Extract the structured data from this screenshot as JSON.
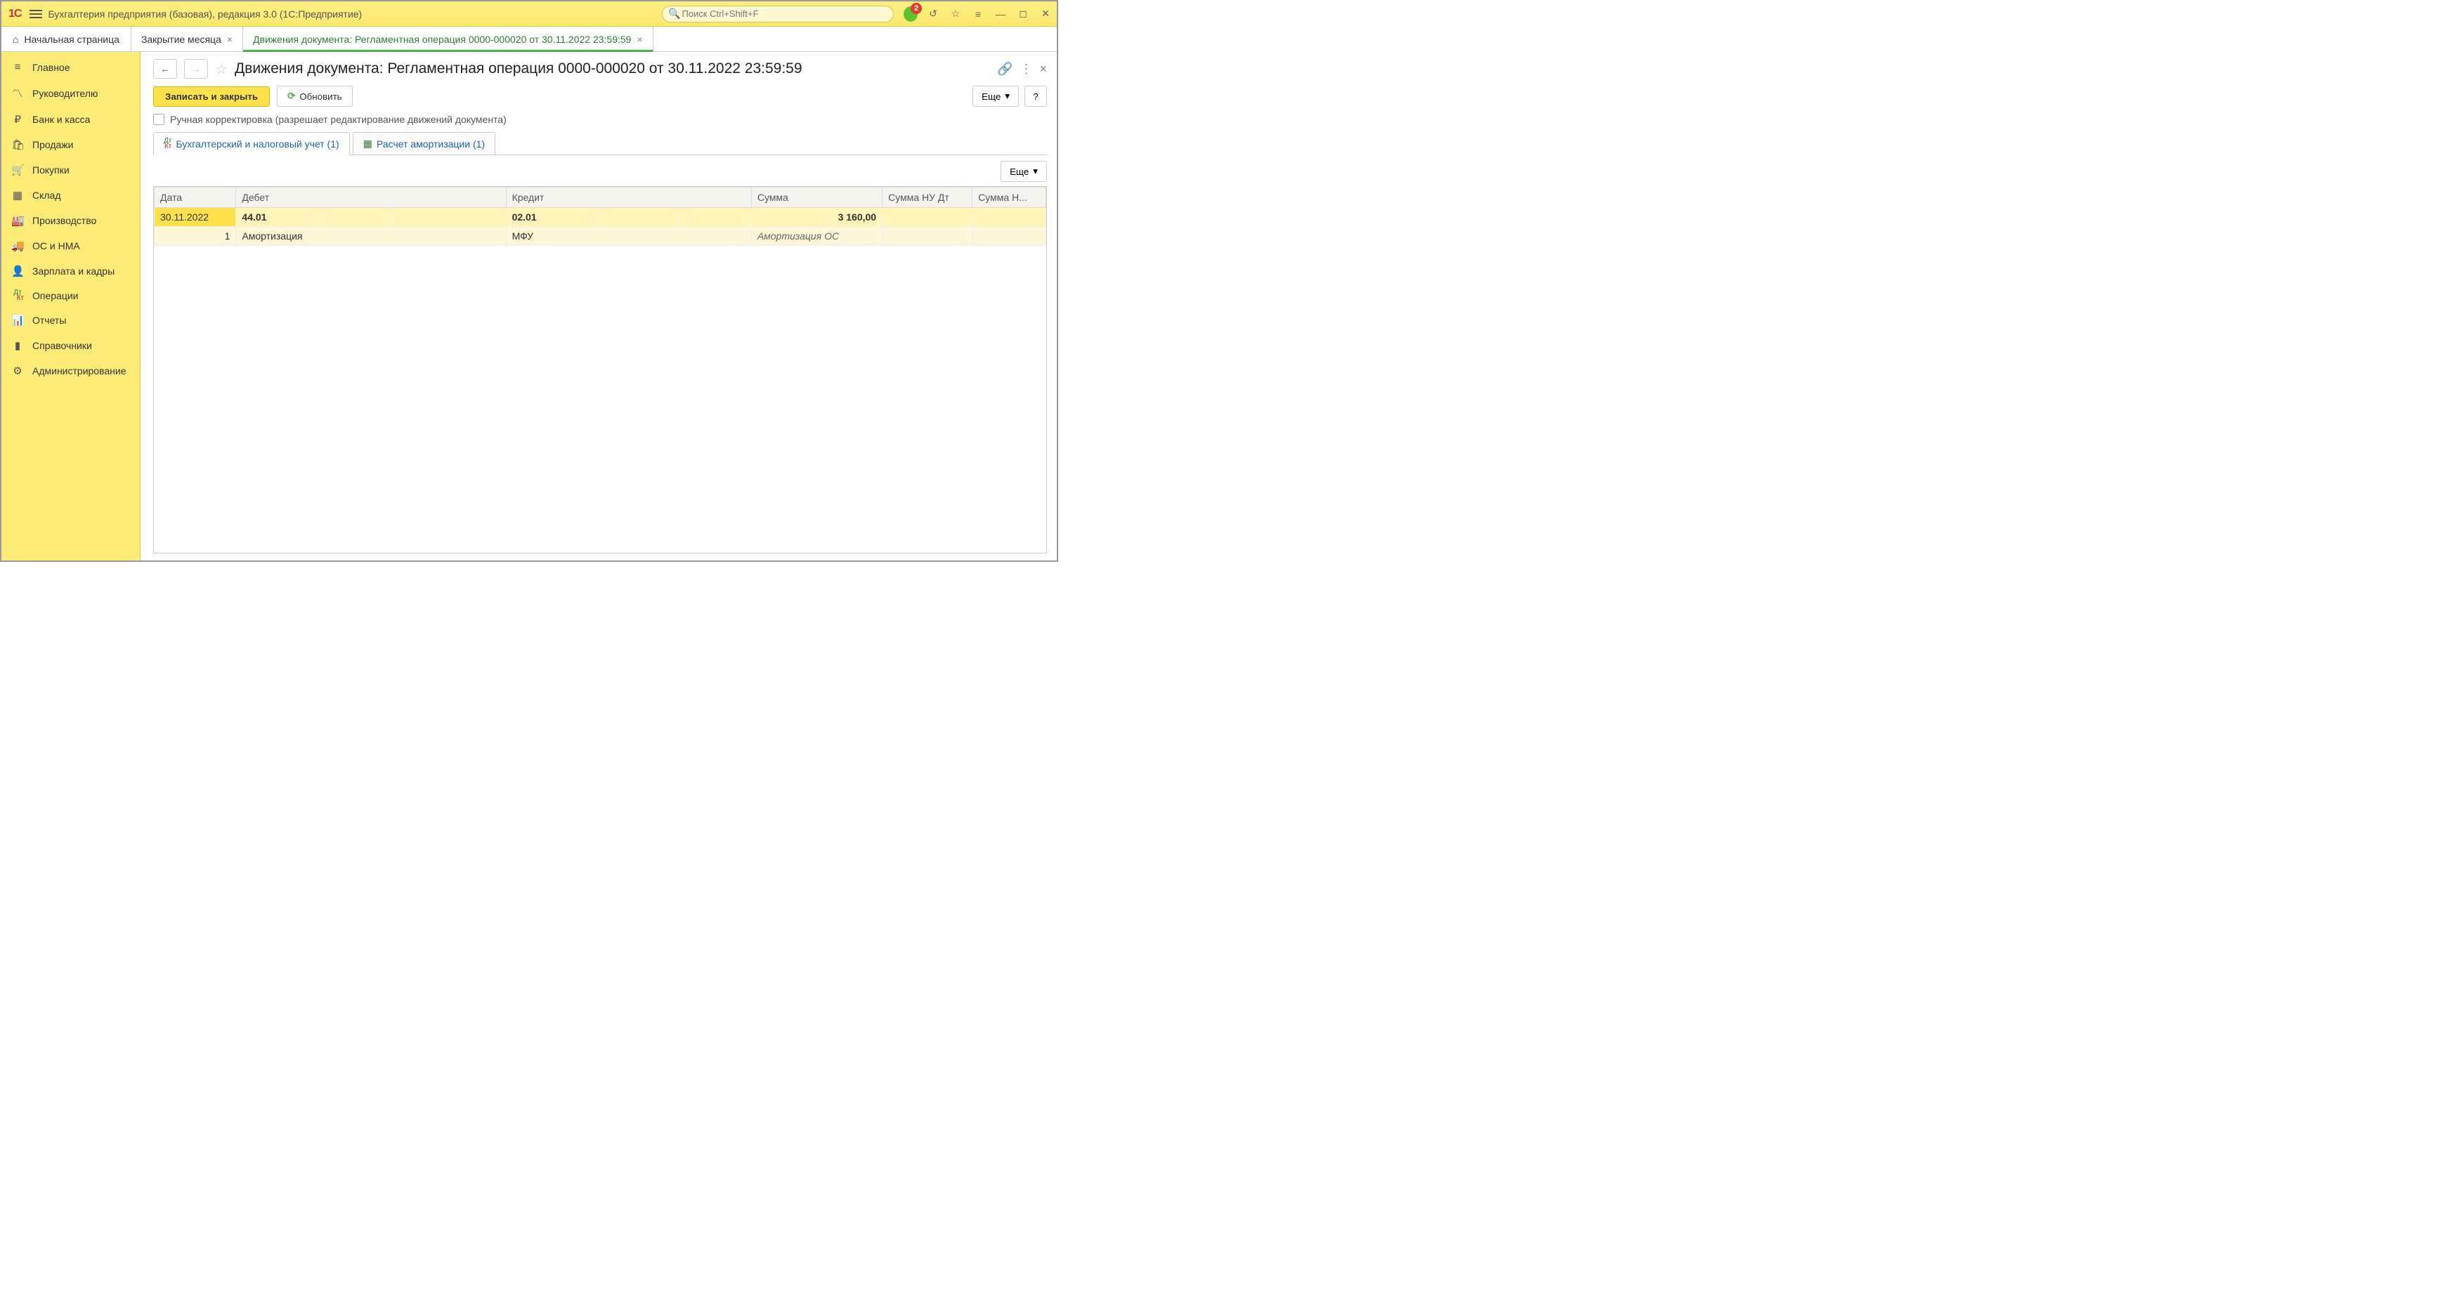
{
  "app": {
    "title": "Бухгалтерия предприятия (базовая), редакция 3.0  (1С:Предприятие)",
    "search_placeholder": "Поиск Ctrl+Shift+F",
    "notification_count": "2"
  },
  "tabs": {
    "home": "Начальная страница",
    "t1": "Закрытие месяца",
    "t2": "Движения документа: Регламентная операция 0000-000020 от 30.11.2022 23:59:59"
  },
  "sidebar": {
    "items": [
      "Главное",
      "Руководителю",
      "Банк и касса",
      "Продажи",
      "Покупки",
      "Склад",
      "Производство",
      "ОС и НМА",
      "Зарплата и кадры",
      "Операции",
      "Отчеты",
      "Справочники",
      "Администрирование"
    ]
  },
  "page": {
    "title": "Движения документа: Регламентная операция 0000-000020 от 30.11.2022 23:59:59"
  },
  "toolbar": {
    "save_close": "Записать и закрыть",
    "refresh": "Обновить",
    "more": "Еще",
    "help": "?"
  },
  "manual_edit_label": "Ручная корректировка (разрешает редактирование движений документа)",
  "inner_tabs": {
    "t1": "Бухгалтерский и налоговый учет (1)",
    "t2": "Расчет амортизации (1)"
  },
  "table": {
    "more": "Еще",
    "headers": {
      "date": "Дата",
      "debit": "Дебет",
      "credit": "Кредит",
      "sum": "Сумма",
      "sum_nu_dt": "Сумма НУ Дт",
      "sum_nu_kt": "Сумма Н..."
    },
    "row1": {
      "date": "30.11.2022",
      "debit_acc": "44.01",
      "credit_acc": "02.01",
      "sum": "3 160,00"
    },
    "row2": {
      "num": "1",
      "debit_subconto": "Амортизация",
      "credit_subconto": "МФУ",
      "content": "Амортизация ОС"
    }
  }
}
